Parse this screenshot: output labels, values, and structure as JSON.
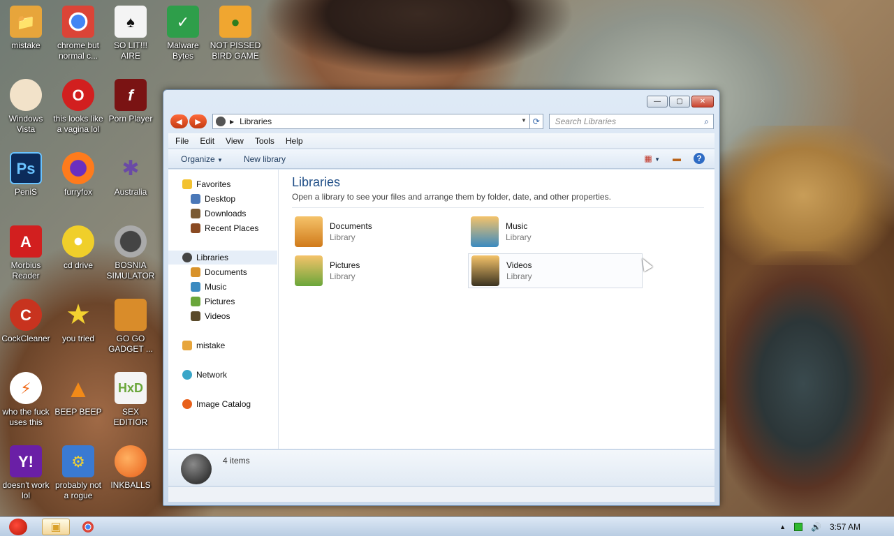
{
  "desktop_icons": [
    {
      "label": "mistake",
      "icon": "user-folder-icon",
      "color": "#e7a53b"
    },
    {
      "label": "chrome but normal c...",
      "icon": "chrome-icon",
      "color": "#1a73e8"
    },
    {
      "label": "SO LIT!!! AIRE",
      "icon": "playing-card-icon",
      "color": "#eaeaea"
    },
    {
      "label": "Malware Bytes",
      "icon": "shield-check-icon",
      "color": "#2e9e4a"
    },
    {
      "label": "NOT PISSED BIRD GAME",
      "icon": "green-pig-icon",
      "color": "#f0a630"
    },
    {
      "label": "Windows Vista",
      "icon": "egg-icon",
      "color": "#f2e2c9"
    },
    {
      "label": "this looks like a vagina lol",
      "icon": "opera-icon",
      "color": "#d21f1f"
    },
    {
      "label": "Porn Player",
      "icon": "flash-icon",
      "color": "#7a1313"
    },
    {
      "label": "PeniS",
      "icon": "photoshop-icon",
      "color": "#0c2b5a"
    },
    {
      "label": "furryfox",
      "icon": "firefox-icon",
      "color": "#ff7b1c"
    },
    {
      "label": "Australia",
      "icon": "spider-icon",
      "color": "#6a4aa6"
    },
    {
      "label": "Morbius Reader",
      "icon": "pdf-icon",
      "color": "#d21f1f"
    },
    {
      "label": "cd drive",
      "icon": "cd-icon",
      "color": "#f0cf2a"
    },
    {
      "label": "BOSNIA SIMULATOR",
      "icon": "mine-icon",
      "color": "#7a7a7a"
    },
    {
      "label": "CockCleaner",
      "icon": "ccleaner-icon",
      "color": "#c8331f"
    },
    {
      "label": "you tried",
      "icon": "star-icon",
      "color": "#f3d230"
    },
    {
      "label": "GO GO GADGET ...",
      "icon": "briefcase-icon",
      "color": "#d98c2a"
    },
    {
      "label": "who the fuck uses this",
      "icon": "lightning-icon",
      "color": "#f06a1a"
    },
    {
      "label": "BEEP BEEP",
      "icon": "vlc-cone-icon",
      "color": "#f28a18"
    },
    {
      "label": "SEX EDITIOR",
      "icon": "hxd-icon",
      "color": "#6aa63a"
    },
    {
      "label": "doesn't work lol",
      "icon": "yahoo-icon",
      "color": "#6a1fa6"
    },
    {
      "label": "probably not a rogue",
      "icon": "gears-monitor-icon",
      "color": "#3a7ad2"
    },
    {
      "label": "INKBALLS",
      "icon": "inkball-icon",
      "color": "#e8601a"
    }
  ],
  "window": {
    "controls": {
      "minimize": "—",
      "maximize": "▢",
      "close": "✕"
    },
    "address": {
      "path": "Libraries"
    },
    "search": {
      "placeholder": "Search Libraries"
    },
    "menu": [
      "File",
      "Edit",
      "View",
      "Tools",
      "Help"
    ],
    "commands": {
      "organize": "Organize",
      "new_library": "New library"
    },
    "nav": {
      "favorites": {
        "label": "Favorites",
        "items": [
          "Desktop",
          "Downloads",
          "Recent Places"
        ]
      },
      "libraries": {
        "label": "Libraries",
        "items": [
          "Documents",
          "Music",
          "Pictures",
          "Videos"
        ]
      },
      "homegroup": "mistake",
      "network": "Network",
      "image_catalog": "Image Catalog"
    },
    "content": {
      "title": "Libraries",
      "subtitle": "Open a library to see your files and arrange them by folder, date, and other properties.",
      "libraries": [
        {
          "name": "Documents",
          "type": "Library"
        },
        {
          "name": "Music",
          "type": "Library"
        },
        {
          "name": "Pictures",
          "type": "Library"
        },
        {
          "name": "Videos",
          "type": "Library"
        }
      ]
    },
    "details": {
      "count": "4 items"
    }
  },
  "taskbar": {
    "clock": "3:57 AM"
  },
  "colors": {
    "accent": "#1e4d86",
    "nav_button": "#e8522a"
  }
}
